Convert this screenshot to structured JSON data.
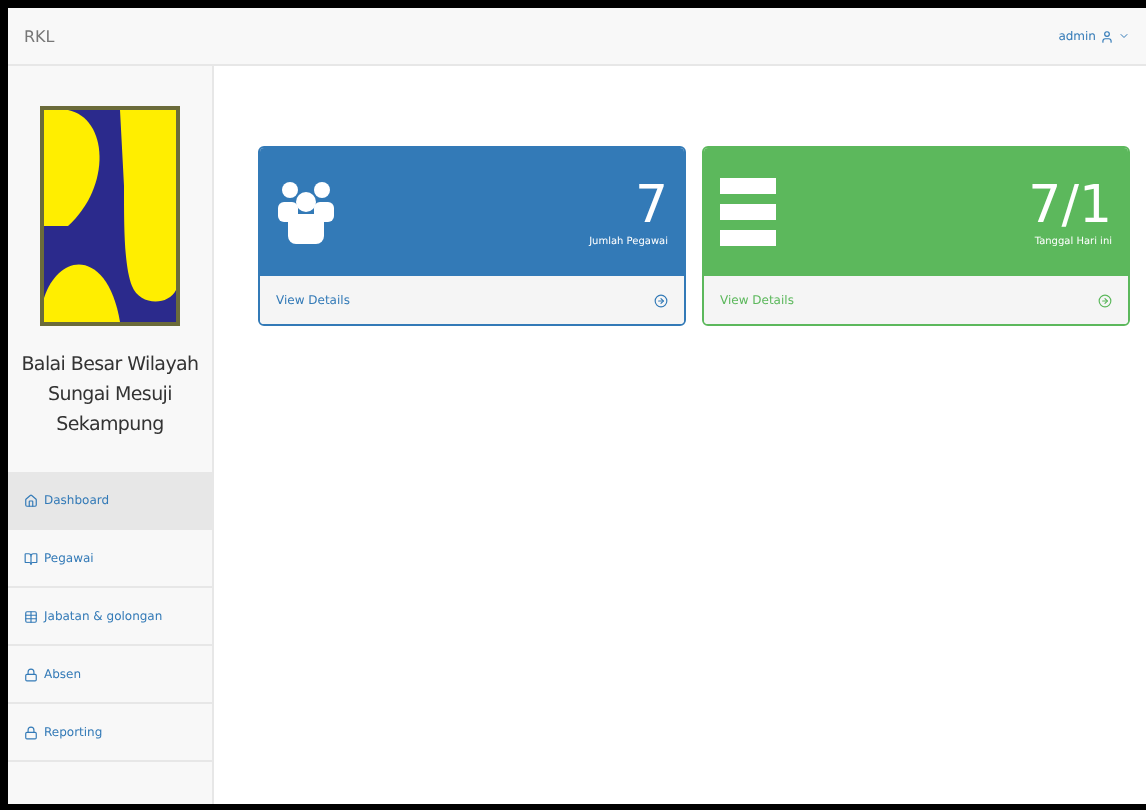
{
  "navbar": {
    "brand": "RKL",
    "user": "admin"
  },
  "sidebar": {
    "org_name": "Balai Besar Wilayah Sungai Mesuji Sekampung",
    "items": [
      {
        "label": "Dashboard",
        "selected": true
      },
      {
        "label": "Pegawai",
        "selected": false
      },
      {
        "label": "Jabatan & golongan",
        "selected": false
      },
      {
        "label": "Absen",
        "selected": false
      },
      {
        "label": "Reporting",
        "selected": false
      }
    ]
  },
  "cards": [
    {
      "kind": "users",
      "color": "#337ab7",
      "value": "7",
      "caption": "Jumlah Pegawai",
      "link": "View Details"
    },
    {
      "kind": "list",
      "color": "#5cb85c",
      "value": "7/1",
      "caption": "Tanggal Hari ini",
      "link": "View Details"
    }
  ]
}
